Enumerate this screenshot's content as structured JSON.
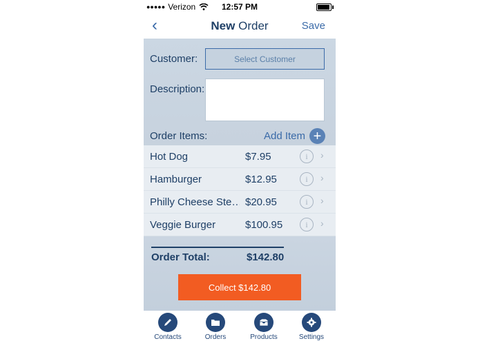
{
  "status": {
    "carrier": "Verizon",
    "time": "12:57 PM",
    "signal": "●●●●●"
  },
  "nav": {
    "back_icon": "‹",
    "title_bold": "New",
    "title_rest": "Order",
    "save": "Save"
  },
  "form": {
    "customer_label": "Customer:",
    "customer_button": "Select Customer",
    "description_label": "Description:",
    "description_value": "",
    "order_items_label": "Order Items:",
    "add_item": "Add Item",
    "add_icon": "+"
  },
  "items": [
    {
      "name": "Hot Dog",
      "price": "$7.95"
    },
    {
      "name": "Hamburger",
      "price": "$12.95"
    },
    {
      "name": "Philly Cheese Ste…",
      "price": "$20.95"
    },
    {
      "name": "Veggie Burger",
      "price": "$100.95"
    }
  ],
  "item_info_icon": "i",
  "item_chevron_icon": "›",
  "totals": {
    "label": "Order Total:",
    "value": "$142.80",
    "collect": "Collect $142.80"
  },
  "tabs": [
    {
      "label": "Contacts",
      "icon": "pencil-icon"
    },
    {
      "label": "Orders",
      "icon": "folder-icon"
    },
    {
      "label": "Products",
      "icon": "inbox-icon"
    },
    {
      "label": "Settings",
      "icon": "gear-icon"
    }
  ],
  "colors": {
    "accent": "#3a6aa8",
    "navy": "#1e3f66",
    "collect": "#f25c22",
    "tab_icon": "#26497a"
  }
}
